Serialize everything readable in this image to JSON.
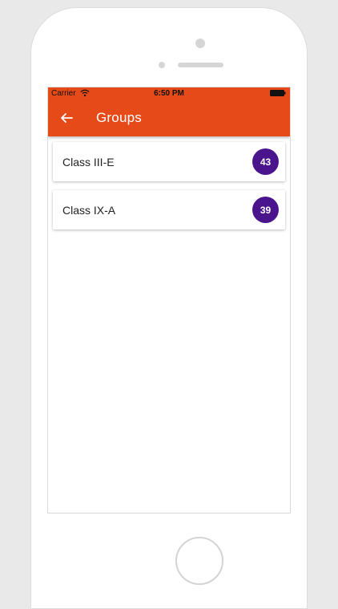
{
  "status_bar": {
    "carrier": "Carrier",
    "time": "6:50 PM"
  },
  "app_bar": {
    "title": "Groups",
    "back_icon": "arrow-back-icon"
  },
  "groups": [
    {
      "name": "Class III-E",
      "count": "43"
    },
    {
      "name": "Class IX-A",
      "count": "39"
    }
  ],
  "colors": {
    "primary": "#e64a19",
    "badge": "#4a148c",
    "background": "#e9e9e9"
  }
}
